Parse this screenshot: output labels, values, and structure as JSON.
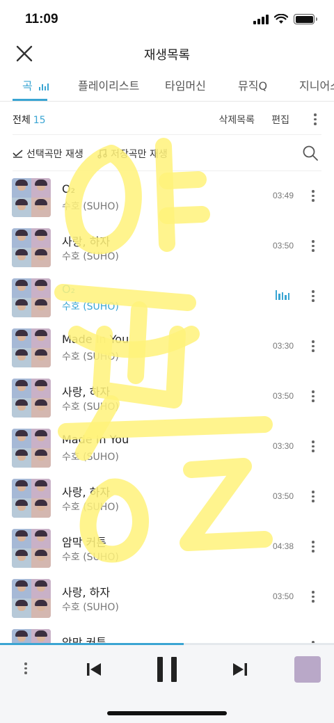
{
  "status": {
    "time": "11:09"
  },
  "header": {
    "title": "재생목록",
    "close_icon": "close-icon"
  },
  "tabs": [
    {
      "label": "곡",
      "active": true
    },
    {
      "label": "플레이리스트",
      "active": false
    },
    {
      "label": "타임머신",
      "active": false
    },
    {
      "label": "뮤직Q",
      "active": false
    },
    {
      "label": "지니어스",
      "active": false
    }
  ],
  "toolbar": {
    "total_label": "전체",
    "total_count": "15",
    "delete_list": "삭제목록",
    "edit": "편집"
  },
  "subbar": {
    "play_selected": "선택곡만 재생",
    "play_saved": "저장곡만 재생"
  },
  "songs": [
    {
      "title": "O₂",
      "artist": "수호 (SUHO)",
      "duration": "03:49",
      "playing": false
    },
    {
      "title": "사랑, 하자",
      "artist": "수호 (SUHO)",
      "duration": "03:50",
      "playing": false
    },
    {
      "title": "O₂",
      "artist": "수호 (SUHO)",
      "duration": "",
      "playing": true
    },
    {
      "title": "Made In You",
      "artist": "수호 (SUHO)",
      "duration": "03:30",
      "playing": false
    },
    {
      "title": "사랑, 하자",
      "artist": "수호 (SUHO)",
      "duration": "03:50",
      "playing": false
    },
    {
      "title": "Made In You",
      "artist": "수호 (SUHO)",
      "duration": "03:30",
      "playing": false
    },
    {
      "title": "사랑, 하자",
      "artist": "수호 (SUHO)",
      "duration": "03:50",
      "playing": false
    },
    {
      "title": "암막 커튼",
      "artist": "수호 (SUHO)",
      "duration": "04:38",
      "playing": false
    },
    {
      "title": "사랑, 하자",
      "artist": "수호 (SUHO)",
      "duration": "03:50",
      "playing": false
    },
    {
      "title": "암막 커튼",
      "artist": "",
      "duration": "",
      "playing": false
    }
  ],
  "player": {
    "progress_fraction": 0.55
  },
  "colors": {
    "accent": "#3aa5d3",
    "highlighter": "#fff27a"
  }
}
